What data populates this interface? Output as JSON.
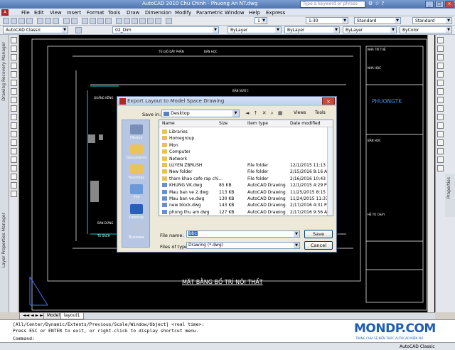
{
  "window": {
    "title": "AutoCAD 2010      Chu Chinh - Phuong An NT.dwg",
    "search_placeholder": "Type a keyword or phrase",
    "controls": [
      "_",
      "□",
      "×"
    ]
  },
  "menu": [
    "File",
    "Edit",
    "View",
    "Insert",
    "Format",
    "Tools",
    "Draw",
    "Dimension",
    "Modify",
    "Parametric",
    "Window",
    "Help",
    "Express"
  ],
  "toolbar": {
    "workspace": "AutoCAD Classic",
    "layer": "02_Dim",
    "scale": "1:30",
    "textstyle": "Standard",
    "dimstyle": "Standard",
    "color": "ByLayer",
    "linetype": "ByLayer",
    "lineweight": "ByLayer",
    "plotstyle": "ByColor",
    "annotation_scale": "1"
  },
  "palettes": {
    "left_top": "Drawing Recovery Manager",
    "left_bottom": "Layer Properties Manager",
    "right": "Properties"
  },
  "drawing": {
    "title": "MẶT BẰNG BỐ TRÍ NỘI THẤT",
    "brand": "PHUONGTK",
    "labels": [
      "TỦ GIỎ DÂY PHẦN",
      "BẢN HỌC",
      "QUẦNG KÉNG",
      "BẢN NƯỚC",
      "TỦ SÁCH",
      "BÀN ĐỨNG",
      "NHÀ TRÍ TUỆ",
      "NHÀ HỌC",
      "BẢN HỌC",
      "HỆ TÙ CHẠY"
    ]
  },
  "tabs": [
    "Model",
    "layout1"
  ],
  "dialog": {
    "title": "Export Layout to Model Space Drawing",
    "close": "×",
    "save_in_label": "Save in:",
    "save_in_value": "Desktop",
    "views_menu": "Views",
    "tools_menu": "Tools",
    "places": [
      "History",
      "Documents",
      "Favorites",
      "FTP",
      "Desktop",
      "Buzzsaw"
    ],
    "columns": [
      "Name",
      "Size",
      "Item type",
      "Date modified"
    ],
    "files": [
      {
        "name": "Libraries",
        "size": "",
        "type": "",
        "date": ""
      },
      {
        "name": "Homegroup",
        "size": "",
        "type": "",
        "date": ""
      },
      {
        "name": "Mon",
        "size": "",
        "type": "",
        "date": ""
      },
      {
        "name": "Computer",
        "size": "",
        "type": "",
        "date": ""
      },
      {
        "name": "Network",
        "size": "",
        "type": "",
        "date": ""
      },
      {
        "name": "LUYEN ZBRUSH",
        "size": "",
        "type": "File folder",
        "date": "12/1/2015 11:13 AM"
      },
      {
        "name": "New folder",
        "size": "",
        "type": "File folder",
        "date": "2/15/2016 8:16 AM"
      },
      {
        "name": "tham khao cafe rap chi...",
        "size": "",
        "type": "File folder",
        "date": "2/16/2016 10:43 AM"
      },
      {
        "name": "KHUNG VK.dwg",
        "size": "85 KB",
        "type": "AutoCAD Drawing",
        "date": "12/1/2015 4:29 PM"
      },
      {
        "name": "Mau ban ve 2.dwg",
        "size": "113 KB",
        "type": "AutoCAD Drawing",
        "date": "11/25/2015 8:15 AM"
      },
      {
        "name": "Mau ban ve.dwg",
        "size": "130 KB",
        "type": "AutoCAD Drawing",
        "date": "11/24/2015 11:37 AM"
      },
      {
        "name": "new block.dwg",
        "size": "143 KB",
        "type": "AutoCAD Drawing",
        "date": "2/17/2016 4:31 PM"
      },
      {
        "name": "phong thu am.dwg",
        "size": "127 KB",
        "type": "AutoCAD Drawing",
        "date": "2/17/2016 9:56 AM"
      }
    ],
    "file_name_label": "File name:",
    "file_name_value": "bbc",
    "files_of_type_label": "Files of type:",
    "files_of_type_value": "Drawing (*.dwg)",
    "save_button": "Save",
    "cancel_button": "Cancel"
  },
  "command": {
    "line1": "[All/Center/Dynamic/Extents/Previous/Scale/Window/Object] <real time>:",
    "line2": "Press ESC or ENTER to exit, or right-click to display shortcut menu.",
    "line3": "Command:"
  },
  "status": {
    "coords": "",
    "right": "AutoCAD Classic"
  },
  "watermark": {
    "main": "MONDP.COM",
    "sub": "TRANG CHIA SẺ KIẾN THỨC AUTOCAD MIỄN PHÍ"
  }
}
